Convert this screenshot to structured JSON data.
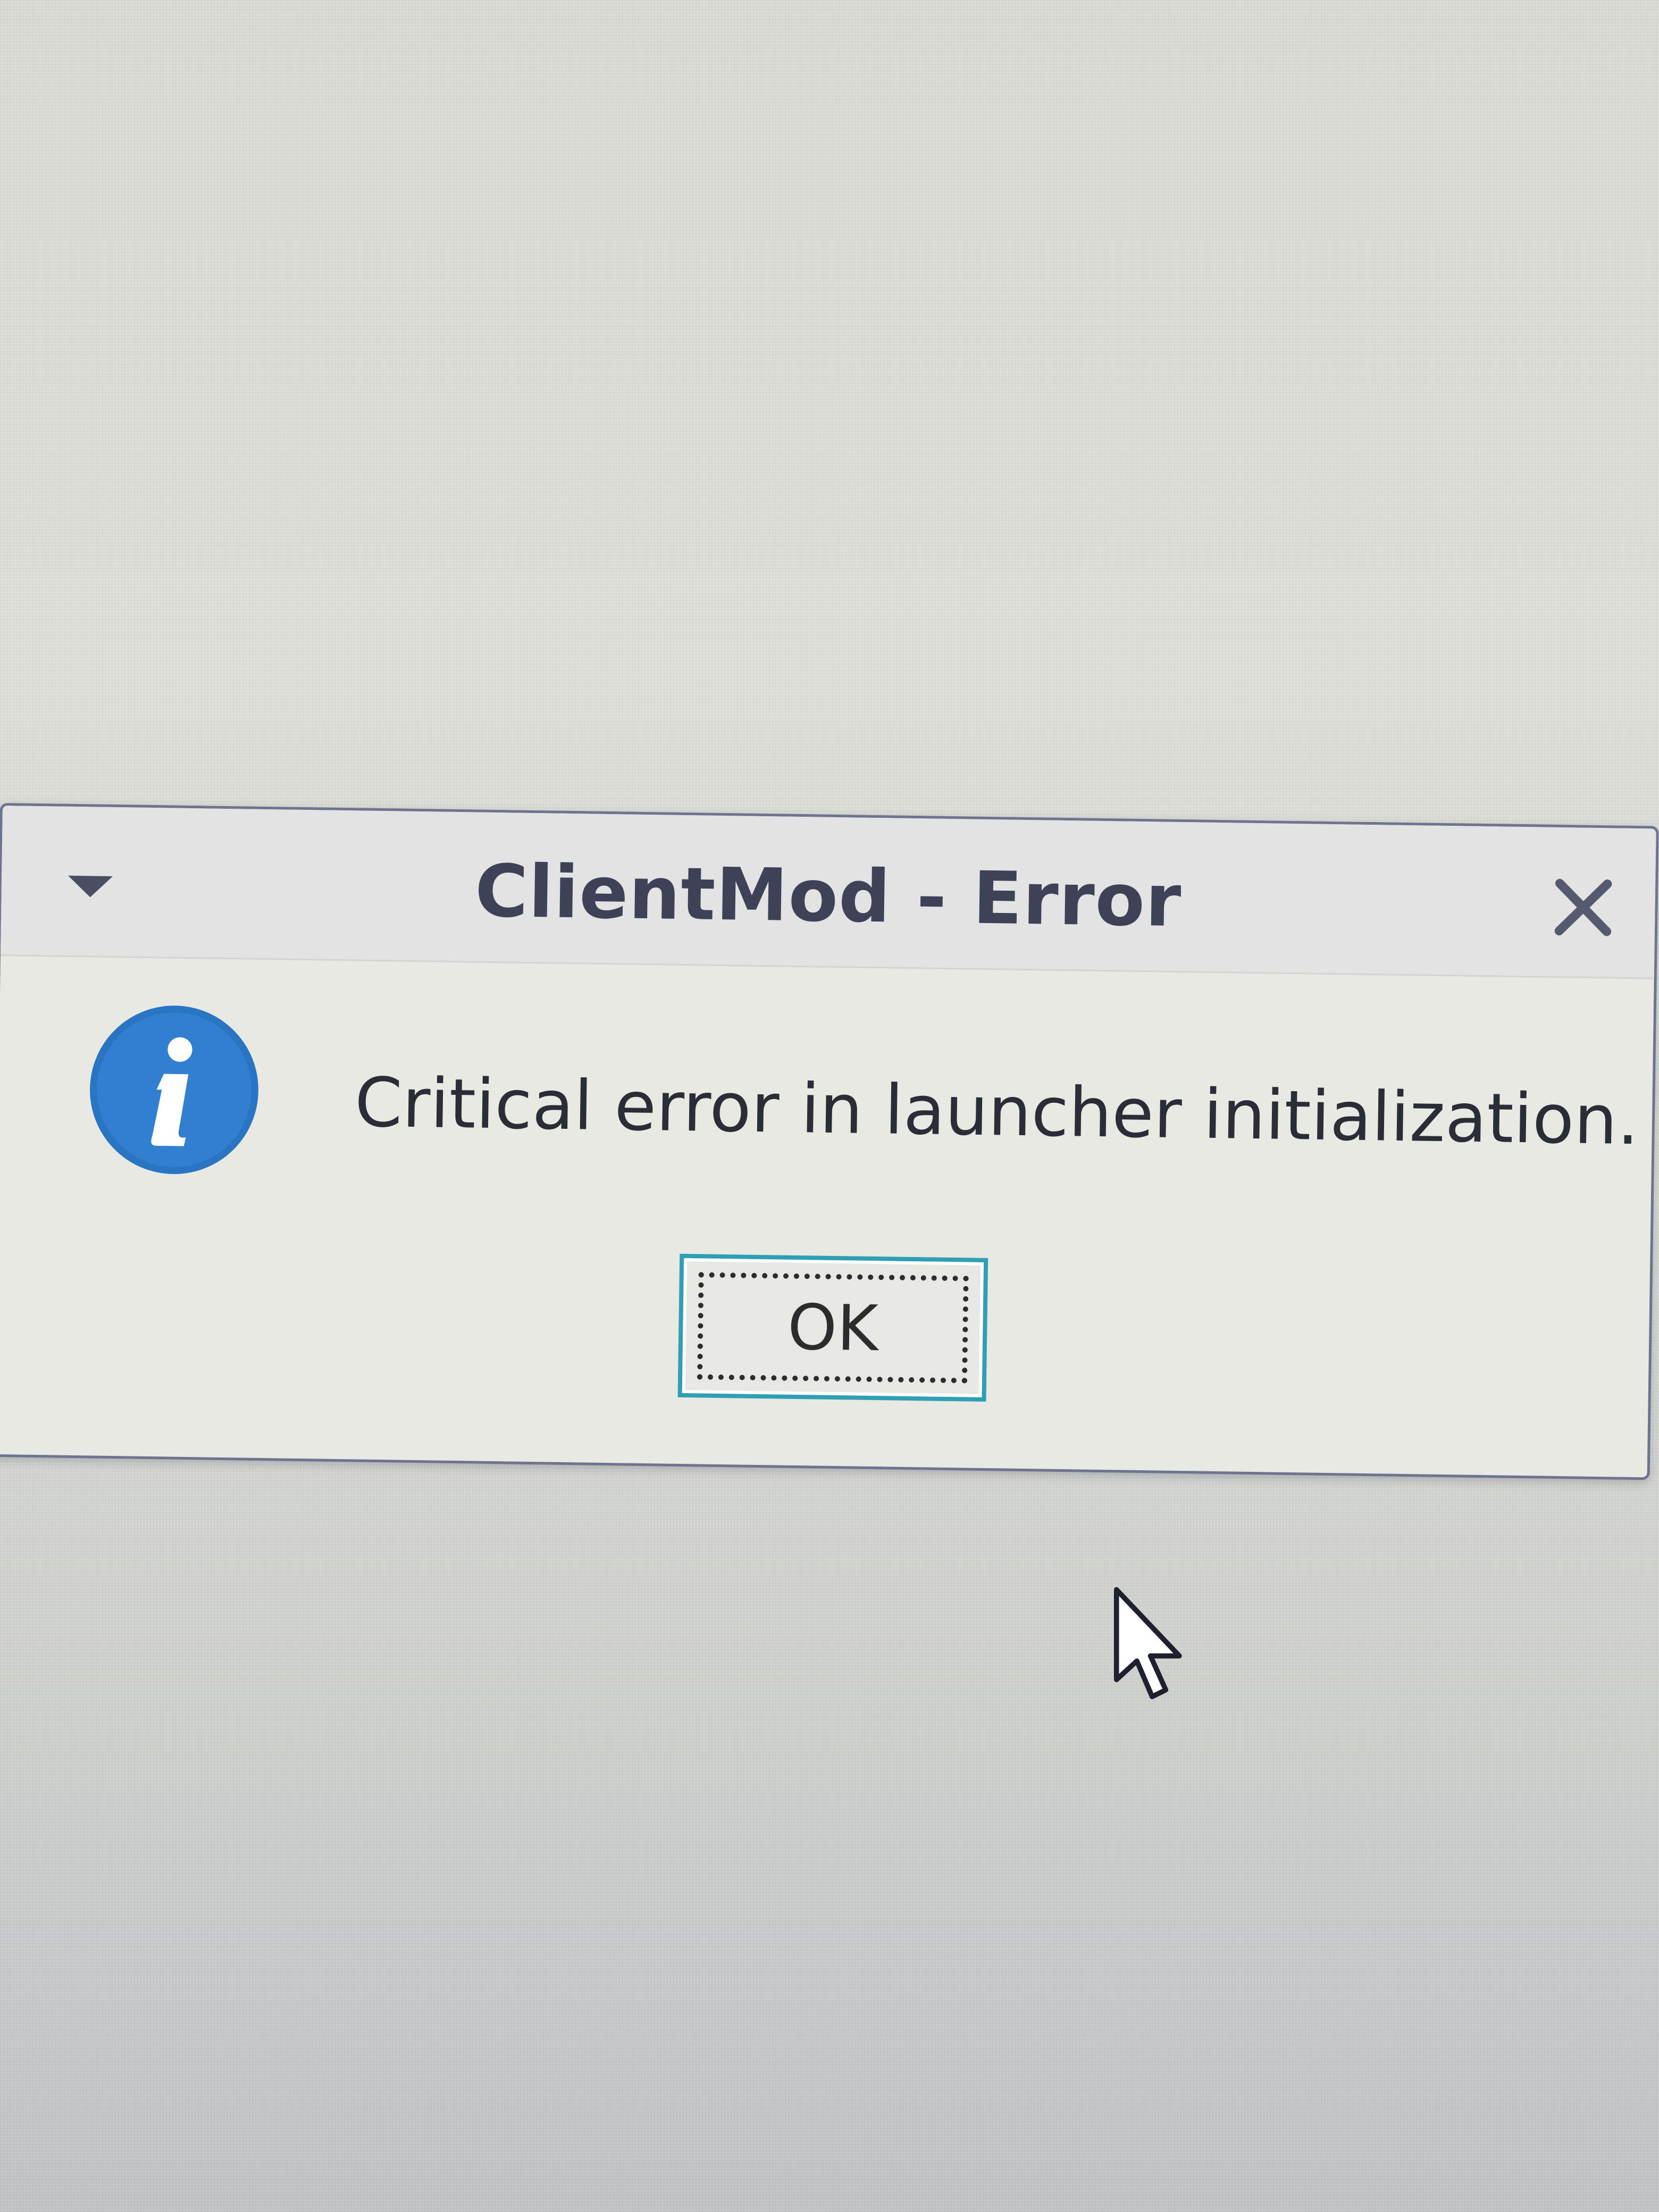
{
  "dialog": {
    "title": "ClientMod - Error",
    "message": "Critical error in launcher initialization.",
    "ok_label": "OK",
    "icon": "info-icon",
    "close_icon": "close-icon",
    "menu_icon": "window-menu-arrow-icon"
  },
  "colors": {
    "accent": "#2f9fb6",
    "info_icon": "#2a74c4",
    "title_text": "#3e4258"
  },
  "cursor": "mouse-pointer-icon"
}
